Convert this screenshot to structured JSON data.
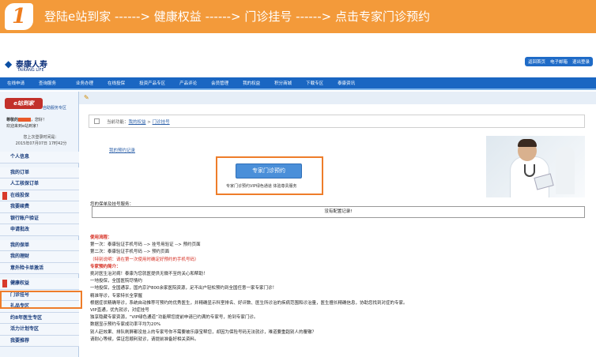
{
  "banner": {
    "step": "1",
    "text": "登陆e站到家 ------> 健康权益 ------> 门诊挂号 ------> 点击专家门诊预约"
  },
  "header": {
    "logo_cn": "泰康人寿",
    "logo_en": "TAIKANG LIFE",
    "toplinks": [
      "返回首页",
      "电子邮箱",
      "退出登录"
    ]
  },
  "navbar": [
    "在线申请",
    "查询服务",
    "业务办理",
    "在线投保",
    "投资产品专区",
    "产品评论",
    "会员管理",
    "我的权益",
    "积分商城",
    "下载专区",
    "泰康资讯"
  ],
  "sidebar": {
    "logo": "e站到家",
    "logo_sub": "自助服务专区",
    "greeting_prefix": "尊敬的",
    "greeting_suffix": "，您好！",
    "welcome": "欢迎来到e站到家！",
    "last_login_label": "您上次登录时间是：",
    "last_login_time": "2015年07月07日 17时42分",
    "menu": [
      {
        "label": "个人信息",
        "tag": false,
        "gap": false
      },
      {
        "label": "我的订单",
        "tag": false,
        "gap": true
      },
      {
        "label": "人工核保订单",
        "tag": false,
        "gap": false
      },
      {
        "label": "在线投保",
        "tag": true,
        "gap": false
      },
      {
        "label": "我要续费",
        "tag": false,
        "gap": false
      },
      {
        "label": "银行账户验证",
        "tag": false,
        "gap": false
      },
      {
        "label": "申请批改",
        "tag": false,
        "gap": false
      },
      {
        "label": "我的保单",
        "tag": false,
        "gap": true
      },
      {
        "label": "我的理财",
        "tag": false,
        "gap": false
      },
      {
        "label": "意外险卡单激活",
        "tag": false,
        "gap": false
      },
      {
        "label": "健康权益",
        "tag": true,
        "gap": true
      },
      {
        "label": "门诊挂号",
        "tag": false,
        "gap": false
      },
      {
        "label": "礼品专区",
        "tag": false,
        "gap": false
      },
      {
        "label": "约8年医生专区",
        "tag": false,
        "gap": false
      },
      {
        "label": "活力计划专区",
        "tag": false,
        "gap": false
      },
      {
        "label": "我要推荐",
        "tag": false,
        "gap": false
      }
    ]
  },
  "crumb": {
    "prefix": "当前功能：",
    "link": "我的权益",
    "sep": " > ",
    "current": "门诊挂号"
  },
  "main": {
    "reg_link": "我的预约记录",
    "button": "专家门诊预约",
    "button_sub": "专家门诊预约VIP绿色通道 体验尊贵服务",
    "section_label": "您的保单及挂号服务：",
    "empty_text": "没有配置记录!",
    "instructions": [
      {
        "text": "使用流程：",
        "style": "red"
      },
      {
        "text": "第一次：泰康验证手机号码 --> 挂号用验证 --> 预约页面",
        "style": ""
      },
      {
        "text": "第二次：泰康验证手机号码 --> 预约页面",
        "style": ""
      },
      {
        "text": "（特别说明：请在第一次使用时确定好预约的手机号码）",
        "style": "redtxt"
      },
      {
        "text": "专家预约简介：",
        "style": "red"
      },
      {
        "text": "挑对医生治对病！泰康为您就医提供无微不至的关心和帮助！",
        "style": ""
      },
      {
        "text": "一地投保，全国医院尽情约",
        "style": ""
      },
      {
        "text": "一地投保，全国通享，国内京沪800余家医院资源，足不出户轻松预约到全国任意一家专家门诊！",
        "style": ""
      },
      {
        "text": "精准导诊，专家特长全掌握",
        "style": ""
      },
      {
        "text": "根据症状精确导诊，系统自动推荐可预约的优秀医生，并精确显示科室排名、好评数、医生所诊治的疾病范围和诊治量，医生擅长精确信息，协助您找到对症的专家。",
        "style": ""
      },
      {
        "text": "VIP直通，优先就诊，对症挂号",
        "style": ""
      },
      {
        "text": "独享隐藏专家资源，“VIP绿色通道”功能帮您提前申请已约满的专家号，抢到专家门诊。",
        "style": ""
      },
      {
        "text": "数据显示预约专家成功率平均为20%",
        "style": ""
      },
      {
        "text": "别人赶效果、排队刷屏都没挂上的专家号你不需要被乐康宝帮您，却因为保险号码无法就诊，难道要重蹈别人的覆辙？",
        "style": ""
      },
      {
        "text": "请耐心等候，保证您顺利就诊，请提前准备好相关资料。",
        "style": ""
      }
    ]
  }
}
